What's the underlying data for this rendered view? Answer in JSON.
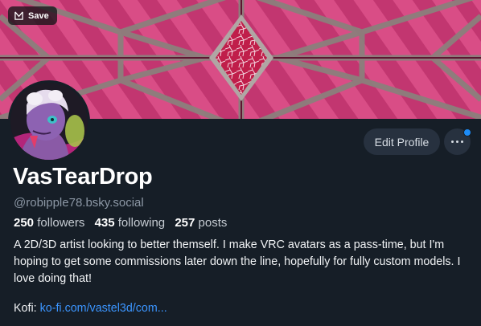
{
  "banner": {
    "save_label": "Save",
    "colors": {
      "base": "#c0326a",
      "frame": "#9a8a86",
      "accent": "#6e1436"
    }
  },
  "profile": {
    "display_name": "VasTearDrop",
    "handle": "@robipple78.bsky.social",
    "stats": {
      "followers_count": "250",
      "followers_label": "followers",
      "following_count": "435",
      "following_label": "following",
      "posts_count": "257",
      "posts_label": "posts"
    },
    "bio": "A 2D/3D artist looking to better themself. I make VRC avatars as a pass-time, but I'm hoping to get some commissions later down the line, hopefully for fully custom models. I love doing that!",
    "kofi_label": "Kofi:",
    "kofi_link": "ko-fi.com/vastel3d/com..."
  },
  "actions": {
    "edit_profile_label": "Edit Profile",
    "more_icon": "ellipsis-icon",
    "notification_dot_color": "#1d8cf8"
  }
}
